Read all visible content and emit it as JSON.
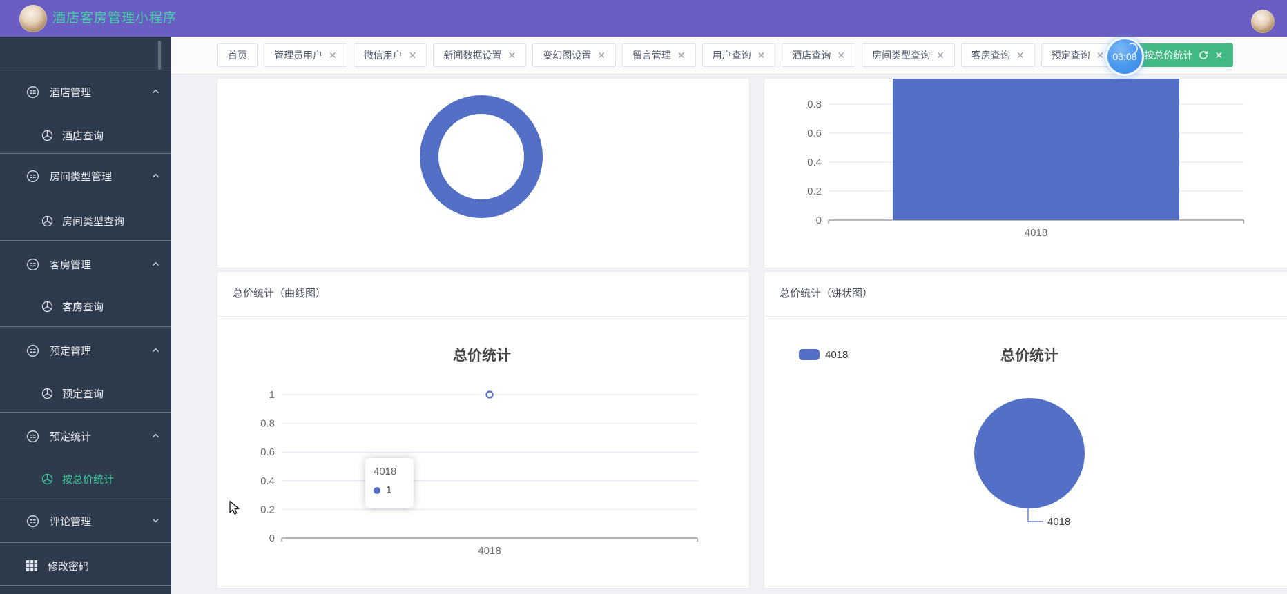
{
  "header": {
    "title": "酒店客房管理小程序"
  },
  "timer": {
    "text": "03:08"
  },
  "tabs": {
    "items": [
      {
        "key": "home",
        "label": "首页",
        "closable": false,
        "active": false
      },
      {
        "key": "admin-users",
        "label": "管理员用户",
        "closable": true,
        "active": false
      },
      {
        "key": "wechat-users",
        "label": "微信用户",
        "closable": true,
        "active": false
      },
      {
        "key": "news-data-settings",
        "label": "新闻数据设置",
        "closable": true,
        "active": false
      },
      {
        "key": "carousel-settings",
        "label": "变幻图设置",
        "closable": true,
        "active": false
      },
      {
        "key": "message-management",
        "label": "留言管理",
        "closable": true,
        "active": false
      },
      {
        "key": "user-query",
        "label": "用户查询",
        "closable": true,
        "active": false
      },
      {
        "key": "hotel-query",
        "label": "酒店查询",
        "closable": true,
        "active": false
      },
      {
        "key": "room-type-query",
        "label": "房间类型查询",
        "closable": true,
        "active": false
      },
      {
        "key": "guest-room-query",
        "label": "客房查询",
        "closable": true,
        "active": false
      },
      {
        "key": "booking-query",
        "label": "预定查询",
        "closable": true,
        "active": false,
        "covered_by_timer": true
      },
      {
        "key": "stats-by-total-price",
        "label": "按总价统计",
        "closable": true,
        "active": true
      }
    ]
  },
  "sidebar": {
    "groups": [
      {
        "key": "hotel-management",
        "label": "酒店管理",
        "expanded": true,
        "children": [
          {
            "key": "hotel-query",
            "label": "酒店查询",
            "active": false
          }
        ]
      },
      {
        "key": "room-type-management",
        "label": "房间类型管理",
        "expanded": true,
        "children": [
          {
            "key": "room-type-query",
            "label": "房间类型查询",
            "active": false
          }
        ]
      },
      {
        "key": "guest-room-management",
        "label": "客房管理",
        "expanded": true,
        "children": [
          {
            "key": "guest-room-query",
            "label": "客房查询",
            "active": false
          }
        ]
      },
      {
        "key": "booking-management",
        "label": "预定管理",
        "expanded": true,
        "children": [
          {
            "key": "booking-query",
            "label": "预定查询",
            "active": false
          }
        ]
      },
      {
        "key": "booking-stats",
        "label": "预定统计",
        "expanded": true,
        "children": [
          {
            "key": "stats-by-total-price",
            "label": "按总价统计",
            "active": true
          }
        ]
      },
      {
        "key": "comment-management",
        "label": "评论管理",
        "expanded": false,
        "children": []
      },
      {
        "key": "change-password",
        "label": "修改密码",
        "single": true,
        "children": []
      }
    ]
  },
  "panels": {
    "line": {
      "header": "总价统计（曲线图）"
    },
    "pie": {
      "header": "总价统计（饼状图）"
    }
  },
  "colors": {
    "chart_blue": "#5470c6",
    "active_green": "#42b983",
    "sidebar_green": "#3ecf9e",
    "header_purple": "#6a5ec4",
    "title_green": "#3fd1a1",
    "axis_label": "#6E7079",
    "grid_line": "#E0E6F1"
  },
  "chart_data": [
    {
      "id": "donut",
      "type": "pie",
      "variant": "donut",
      "values": [
        1
      ],
      "labels": [],
      "color": "#5470c6"
    },
    {
      "id": "bar",
      "type": "bar",
      "categories": [
        "4018"
      ],
      "values": [
        1
      ],
      "yticks_visible": [
        0.8,
        0.6,
        0.4,
        0.2,
        0
      ],
      "ylim": [
        0,
        1
      ],
      "grid": true,
      "color": "#5470c6"
    },
    {
      "id": "line",
      "type": "line",
      "title": "总价统计",
      "categories": [
        "4018"
      ],
      "values": [
        1
      ],
      "yticks": [
        1,
        0.8,
        0.6,
        0.4,
        0.2,
        0
      ],
      "ylim": [
        0,
        1
      ],
      "grid": true,
      "color": "#5470c6",
      "tooltip": {
        "category": "4018",
        "value": 1
      }
    },
    {
      "id": "pie",
      "type": "pie",
      "title": "总价统计",
      "legend": [
        "4018"
      ],
      "legend_position": "top-left",
      "series": [
        {
          "name": "4018",
          "value": 1
        }
      ],
      "color": "#5470c6"
    }
  ]
}
